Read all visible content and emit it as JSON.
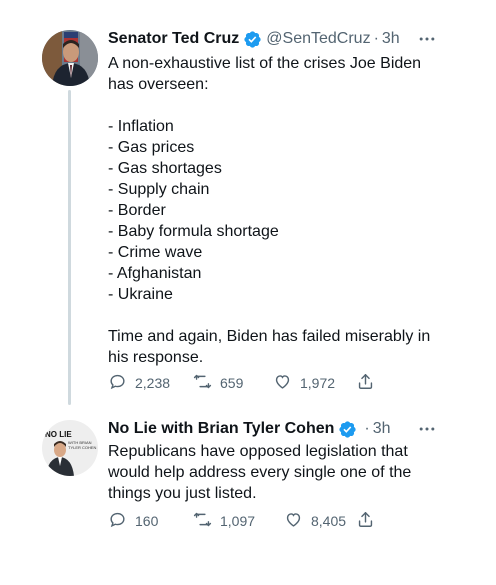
{
  "tweets": [
    {
      "name": "Senator Ted Cruz",
      "handle": "@SenTedCruz",
      "separator": "·",
      "time": "3h",
      "intro": "A non-exhaustive list of the crises Joe Biden has overseen:",
      "list": [
        "- Inflation",
        "- Gas prices",
        "- Gas shortages",
        "- Supply chain",
        "- Border",
        "- Baby formula shortage",
        "- Crime wave",
        "- Afghanistan",
        "- Ukraine"
      ],
      "closing": "Time and again, Biden has failed miserably in his response.",
      "replies": "2,238",
      "retweets": "659",
      "likes": "1,972"
    },
    {
      "name": "No Lie with Brian Tyler Cohen",
      "separator": "·",
      "time": "3h",
      "text": "Republicans have opposed legislation that would help address every single one of the things you just listed.",
      "replies": "160",
      "retweets": "1,097",
      "likes": "8,405",
      "avatar_logo": "NO LIE",
      "avatar_sub": "WITH BRIAN TYLER COHEN"
    }
  ],
  "colors": {
    "verified": "#1d9bf0",
    "secondary_text": "#536471",
    "thread_line": "#cfd9de"
  },
  "icons": [
    "verified-badge-icon",
    "more-options-icon",
    "reply-icon",
    "retweet-icon",
    "like-icon",
    "share-icon"
  ]
}
